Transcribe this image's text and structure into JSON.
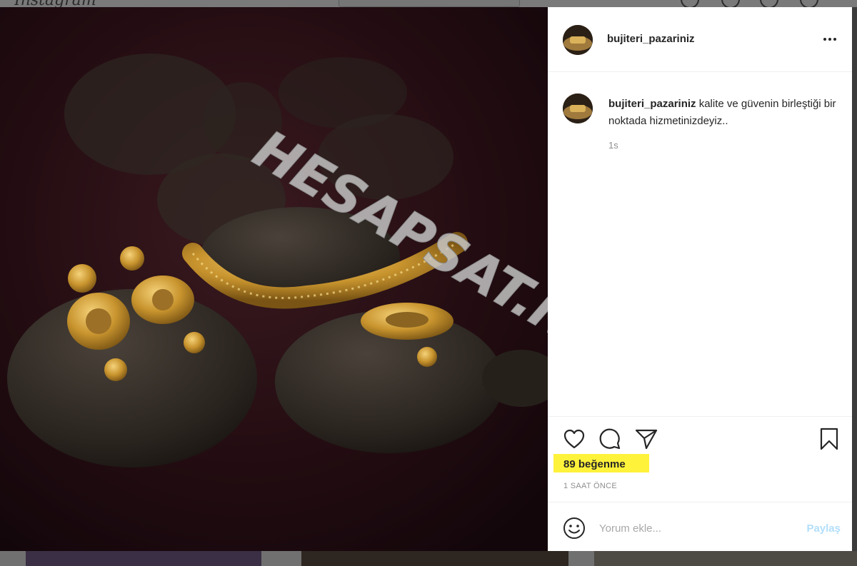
{
  "background": {
    "logo_text": "Instagram"
  },
  "post": {
    "username": "bujiteri_pazariniz",
    "caption_text": "kalite ve güvenin birleştiği bir noktada hizmetinizdeyiz..",
    "caption_time": "1s",
    "likes_label": "89 beğenme",
    "posted_time": "1 SAAT ÖNCE",
    "image_description_icon": "jewelry-photo",
    "watermark_text": "HESAPSAT.NET"
  },
  "comment_box": {
    "placeholder": "Yorum ekle...",
    "post_label": "Paylaş"
  },
  "colors": {
    "highlight": "#fff23a",
    "post_button_disabled": "#b2dffc",
    "text_primary": "#262626",
    "text_secondary": "#8e8e8e"
  },
  "icons": {
    "more": "more-options-icon",
    "like": "heart-icon",
    "comment": "comment-icon",
    "share": "paper-plane-icon",
    "save": "bookmark-icon",
    "emoji": "smiley-icon"
  }
}
